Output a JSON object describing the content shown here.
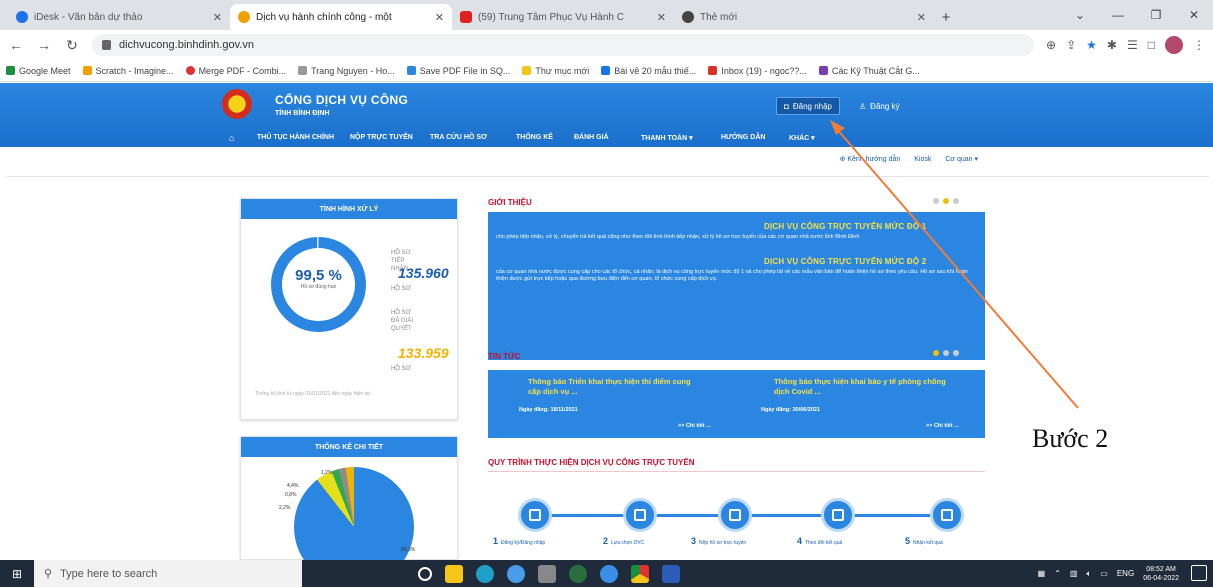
{
  "browser": {
    "tabs": [
      {
        "label": "iDesk - Văn bản dự thảo",
        "color": "#1a73e8",
        "active": false
      },
      {
        "label": "Dịch vụ hành chính công - một",
        "color": "#f0a000",
        "active": true
      },
      {
        "label": "(59) Trung Tâm Phục Vụ Hành C",
        "color": "#e02020",
        "active": false
      },
      {
        "label": "Thẻ mới",
        "color": "#444444",
        "active": false
      }
    ],
    "new_tab": "+",
    "url": "dichvucong.binhdinh.gov.vn",
    "bookmarks": [
      "Google Meet",
      "Scratch - Imagine...",
      "Merge PDF - Combi...",
      "Trang Nguyen - Ho...",
      "Save PDF File in SQ...",
      "Thư mục mới",
      "Bài về 20 mẫu thiế...",
      "Inbox (19) - ngoc??...",
      "Các Kỹ Thuật Cắt G..."
    ]
  },
  "site": {
    "title": "CỔNG DỊCH VỤ CÔNG",
    "subtitle": "TỈNH BÌNH ĐỊNH",
    "login": "Đăng nhập",
    "register": "Đăng ký",
    "menu": {
      "home": "⌂",
      "m1": "THỦ TỤC HÀNH CHÍNH",
      "m2": "NỘP TRỰC TUYẾN",
      "m3": "TRA CỨU HỒ SƠ",
      "m4": "THỐNG KÊ",
      "m5": "ĐÁNH GIÁ",
      "m6": "THANH TOÁN ▾",
      "m7": "HƯỚNG DẪN",
      "m8": "KHÁC ▾"
    },
    "subnav": {
      "a": "⊕ Kênh hướng dẫn",
      "b": "Kiosk",
      "c": "Cơ quan ▾"
    }
  },
  "status_panel": {
    "title": "TÌNH HÌNH XỬ LÝ",
    "percent": "99,5 %",
    "percent_label": "Hồ sơ đúng hạn",
    "received_label": "HỒ SƠ TIẾP NHẬN",
    "received_value": "135.960",
    "received_unit": "HỒ SƠ",
    "solved_label": "HỒ SƠ ĐÃ GIẢI QUYẾT",
    "solved_value": "133.959",
    "solved_unit": "HỒ SƠ",
    "note": "Thống kê tính từ ngày 01/01/2021 đến ngày hiện tại"
  },
  "detail_panel": {
    "title": "THỐNG KÊ CHI TIẾT",
    "labels": [
      "1,2%",
      "4,4%",
      "0,8%",
      "2,2%",
      "89,3%"
    ]
  },
  "intro": {
    "title": "GIỚI THIỆU",
    "h1": "DỊCH VỤ CÔNG TRỰC TUYẾN MỨC ĐỘ 1",
    "p1": "cho phép tiếp nhận, xử lý, chuyển trả kết quả cũng như theo dõi tình hình tiếp nhận, xử lý hồ sơ trực tuyến của các cơ quan nhà nước tỉnh Bình Định",
    "h2": "DỊCH VỤ CÔNG TRỰC TUYẾN MỨC ĐỘ 2",
    "p2": "của cơ quan nhà nước được cung cấp cho các tổ chức, cá nhân; là dịch vụ công trực tuyến mức độ 1 và cho phép tải về các mẫu văn bản để hoàn thiện hồ sơ theo yêu cầu. Hồ sơ sau khi hoàn thiện được gửi trực tiếp hoặc qua đường bưu điện đến cơ quan, tổ chức cung cấp dịch vụ."
  },
  "news": {
    "title": "TIN TỨC",
    "items": [
      {
        "headline": "Thông báo Triển khai thực hiện thí điểm cung cấp dịch vụ ...",
        "date": "Ngày đăng: 18/11/2021",
        "more": ">> Chi tiết ..."
      },
      {
        "headline": "Thông báo thực hiện khai báo y tế phòng chống dịch Covid ...",
        "date": "Ngày đăng: 30/06/2021",
        "more": ">> Chi tiết ..."
      }
    ]
  },
  "process": {
    "title": "QUY TRÌNH THỰC HIỆN DỊCH VỤ CÔNG TRỰC TUYẾN",
    "steps": [
      {
        "num": "1",
        "label": "Đăng ký/Đăng nhập"
      },
      {
        "num": "2",
        "label": "Lựa chọn DVC"
      },
      {
        "num": "3",
        "label": "Nộp hồ sơ trực tuyến"
      },
      {
        "num": "4",
        "label": "Theo dõi kết quả"
      },
      {
        "num": "5",
        "label": "Nhận kết quả"
      }
    ]
  },
  "annotation": {
    "text": "Bước 2",
    "color": "#f07c3a"
  },
  "taskbar": {
    "search_placeholder": "Type here to search",
    "time": "08:52 AM",
    "date": "06-04-2022",
    "lang": "ENG"
  }
}
